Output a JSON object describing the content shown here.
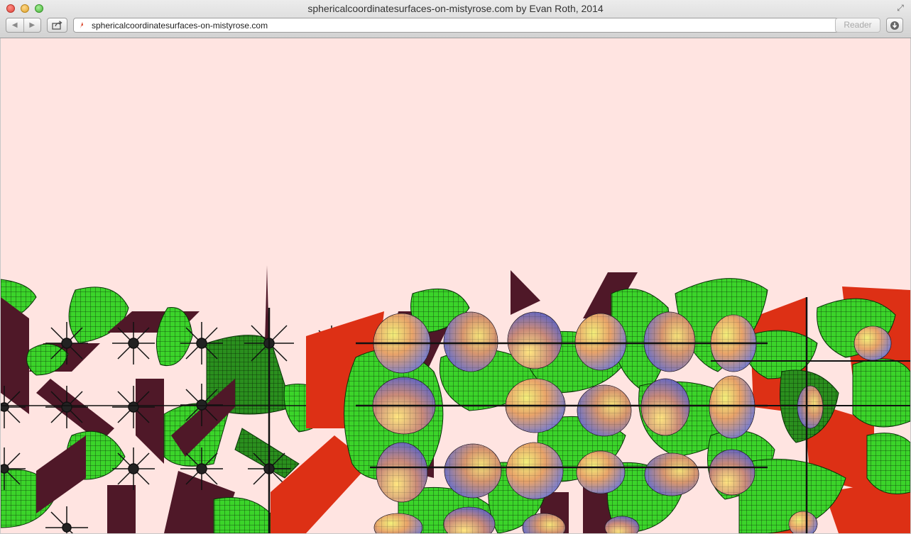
{
  "window": {
    "title": "sphericalcoordinatesurfaces-on-mistyrose.com by Evan Roth, 2014"
  },
  "toolbar": {
    "back_icon": "back-arrow-icon",
    "forward_icon": "forward-arrow-icon",
    "share_icon": "share-icon",
    "address": "sphericalcoordinatesurfaces-on-mistyrose.com",
    "reload_icon": "reload-icon",
    "reader_label": "Reader",
    "download_icon": "download-icon"
  },
  "colors": {
    "page_background": "#ffe4e1",
    "green_surface": "#3bd42a",
    "maroon_plane": "#4f1828",
    "red_plane": "#dd3015",
    "sphere_warm": "#e8a36a",
    "sphere_cool": "#6b78d8"
  }
}
